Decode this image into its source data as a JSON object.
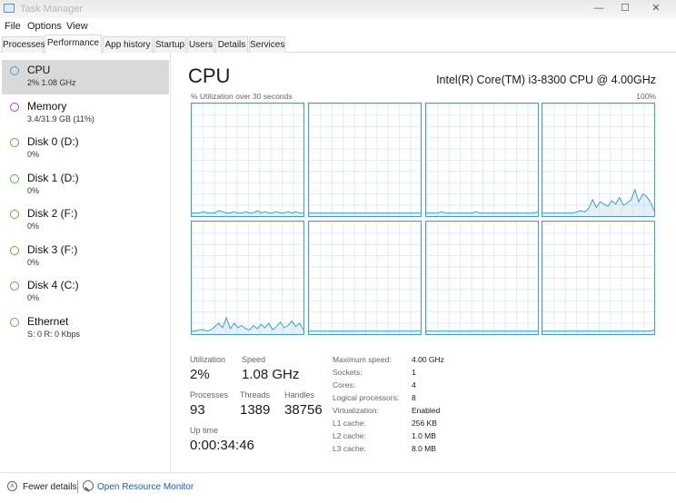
{
  "window": {
    "title": "Task Manager",
    "icon": "task-manager-icon",
    "controls": {
      "minimize": "—",
      "maximize": "☐",
      "close": "✕"
    }
  },
  "menu": [
    "File",
    "Options",
    "View"
  ],
  "tabs": [
    {
      "label": "Processes",
      "active": false
    },
    {
      "label": "Performance",
      "active": true
    },
    {
      "label": "App history",
      "active": false
    },
    {
      "label": "Startup",
      "active": false
    },
    {
      "label": "Users",
      "active": false
    },
    {
      "label": "Details",
      "active": false
    },
    {
      "label": "Services",
      "active": false
    }
  ],
  "sidebar": {
    "items": [
      {
        "name": "CPU",
        "sub": "2%  1.08 GHz",
        "color": "#4ca0d3",
        "selected": true
      },
      {
        "name": "Memory",
        "sub": "3.4/31.9 GB (11%)",
        "color": "#9b4fb0",
        "selected": false
      },
      {
        "name": "Disk 0 (D:)",
        "sub": "0%",
        "color": "#5daa3a",
        "selected": false
      },
      {
        "name": "Disk 1 (D:)",
        "sub": "0%",
        "color": "#5daa3a",
        "selected": false
      },
      {
        "name": "Disk 2 (F:)",
        "sub": "0%",
        "color": "#5daa3a",
        "selected": false
      },
      {
        "name": "Disk 3 (F:)",
        "sub": "0%",
        "color": "#5daa3a",
        "selected": false
      },
      {
        "name": "Disk 4 (C:)",
        "sub": "0%",
        "color": "#5daa3a",
        "selected": false
      },
      {
        "name": "Ethernet",
        "sub": "S: 0  R: 0 Kbps",
        "color": "#b8834b",
        "selected": false
      }
    ]
  },
  "main": {
    "title": "CPU",
    "model": "Intel(R) Core(TM) i3-8300 CPU @ 4.00GHz",
    "utilization_label": "% Utilization over 30 seconds",
    "max_label": "100%",
    "graph_color": "#4a9cc4",
    "graphs": [
      [
        2,
        2,
        2,
        3,
        2,
        2,
        2,
        4,
        3,
        2,
        2,
        3,
        2,
        2,
        3,
        2,
        2,
        4,
        2,
        3,
        2,
        2,
        3,
        2,
        2,
        3,
        2,
        3,
        2,
        2
      ],
      [
        2,
        2,
        2,
        2,
        2,
        2,
        2,
        2,
        2,
        2,
        2,
        2,
        2,
        2,
        2,
        2,
        2,
        2,
        2,
        2,
        2,
        2,
        2,
        2,
        2,
        2,
        2,
        2,
        2,
        2
      ],
      [
        2,
        2,
        2,
        2,
        3,
        2,
        2,
        2,
        2,
        2,
        2,
        2,
        2,
        3,
        2,
        2,
        2,
        2,
        2,
        2,
        2,
        2,
        2,
        2,
        2,
        2,
        2,
        2,
        2,
        3
      ],
      [
        2,
        2,
        2,
        2,
        2,
        2,
        2,
        2,
        2,
        3,
        4,
        3,
        6,
        14,
        7,
        12,
        10,
        8,
        13,
        10,
        16,
        9,
        11,
        14,
        23,
        12,
        19,
        17,
        12,
        4
      ],
      [
        2,
        2,
        3,
        3,
        2,
        3,
        6,
        9,
        5,
        14,
        4,
        9,
        5,
        7,
        4,
        3,
        7,
        4,
        8,
        5,
        9,
        3,
        6,
        10,
        5,
        7,
        11,
        6,
        9,
        3
      ],
      [
        2,
        2,
        2,
        2,
        2,
        2,
        2,
        2,
        2,
        2,
        2,
        2,
        2,
        2,
        2,
        2,
        2,
        2,
        2,
        2,
        2,
        2,
        2,
        2,
        2,
        2,
        2,
        2,
        2,
        2
      ],
      [
        2,
        2,
        2,
        2,
        2,
        2,
        2,
        2,
        2,
        2,
        2,
        2,
        2,
        2,
        2,
        2,
        2,
        2,
        2,
        2,
        2,
        2,
        2,
        2,
        2,
        2,
        2,
        2,
        2,
        2
      ],
      [
        2,
        2,
        2,
        2,
        2,
        2,
        2,
        2,
        2,
        2,
        2,
        2,
        2,
        2,
        2,
        2,
        2,
        2,
        2,
        2,
        2,
        2,
        2,
        2,
        2,
        2,
        2,
        2,
        2,
        3
      ]
    ],
    "stats": {
      "utilization_label": "Utilization",
      "utilization": "2%",
      "speed_label": "Speed",
      "speed": "1.08 GHz",
      "processes_label": "Processes",
      "processes": "93",
      "threads_label": "Threads",
      "threads": "1389",
      "handles_label": "Handles",
      "handles": "38756",
      "uptime_label": "Up time",
      "uptime": "0:00:34:46"
    },
    "specs": [
      {
        "label": "Maximum speed:",
        "value": "4.00 GHz"
      },
      {
        "label": "Sockets:",
        "value": "1"
      },
      {
        "label": "Cores:",
        "value": "4"
      },
      {
        "label": "Logical processors:",
        "value": "8"
      },
      {
        "label": "Virtualization:",
        "value": "Enabled"
      },
      {
        "label": "L1 cache:",
        "value": "256 KB"
      },
      {
        "label": "L2 cache:",
        "value": "1.0 MB"
      },
      {
        "label": "L3 cache:",
        "value": "8.0 MB"
      }
    ]
  },
  "footer": {
    "fewer_details": "Fewer details",
    "fewer_icon": "chevron-up-icon",
    "resource_monitor": "Open Resource Monitor",
    "monitor_icon": "resource-monitor-icon"
  }
}
